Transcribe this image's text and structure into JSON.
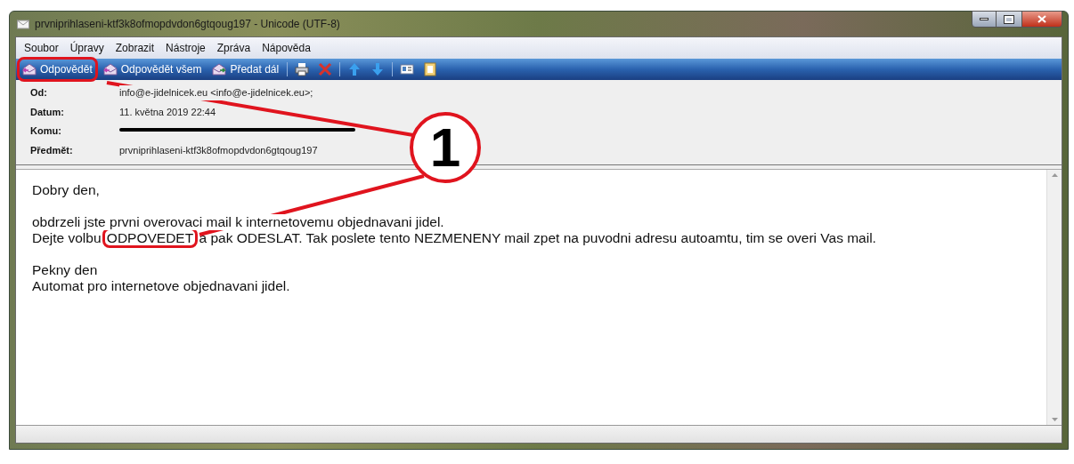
{
  "window": {
    "title": "prvniprihlaseni-ktf3k8ofmopdvdon6gtqoug197 - Unicode (UTF-8)"
  },
  "menu": [
    "Soubor",
    "Úpravy",
    "Zobrazit",
    "Nástroje",
    "Zpráva",
    "Nápověda"
  ],
  "toolbar": [
    {
      "kind": "labeled",
      "label": "Odpovědět",
      "highlighted": true
    },
    {
      "kind": "labeled",
      "label": "Odpovědět všem",
      "highlighted": false
    },
    {
      "kind": "labeled",
      "label": "Předat dál",
      "highlighted": false
    },
    {
      "kind": "icon",
      "highlighted": false
    },
    {
      "kind": "icon",
      "highlighted": false
    },
    {
      "kind": "icon",
      "highlighted": false
    },
    {
      "kind": "icon",
      "highlighted": false
    },
    {
      "kind": "icon",
      "highlighted": false
    },
    {
      "kind": "icon",
      "highlighted": false
    }
  ],
  "headers": [
    {
      "label": "Od:",
      "kind": "text",
      "value": "info@e-jidelnicek.eu <info@e-jidelnicek.eu>;"
    },
    {
      "label": "Datum:",
      "kind": "text",
      "value": "11. května 2019 22:44"
    },
    {
      "label": "Komu:",
      "kind": "redacted"
    },
    {
      "label": "Předmět:",
      "kind": "text",
      "value": "prvniprihlaseni-ktf3k8ofmopdvdon6gtqoug197"
    }
  ],
  "body": [
    {
      "kind": "text",
      "text": "Dobry den,"
    },
    {
      "kind": "gap"
    },
    {
      "kind": "text",
      "text": "obdrzeli jste prvni overovaci mail k internetovemu objednavani jidel."
    },
    {
      "kind": "marked",
      "before": "Dejte volbu ",
      "marked": "ODPOVEDET",
      "after": " a pak ODESLAT. Tak poslete tento NEZMENENY mail zpet na puvodni adresu autoamtu, tim se overi Vas mail."
    },
    {
      "kind": "gap"
    },
    {
      "kind": "text",
      "text": "Pekny den"
    },
    {
      "kind": "text",
      "text": "Automat pro internetove objednavani jidel."
    }
  ],
  "annotation": {
    "label": "1"
  }
}
